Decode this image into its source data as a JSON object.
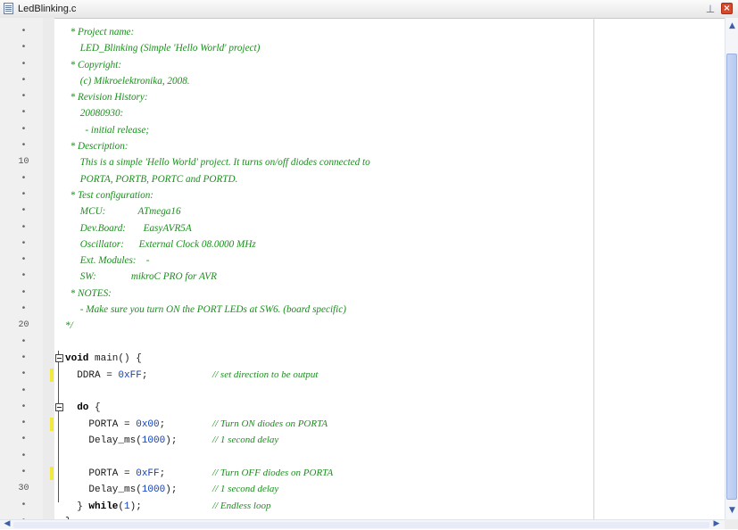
{
  "tab": {
    "title": "LedBlinking.c",
    "pin_icon": "pin-icon",
    "close_icon": "close-icon"
  },
  "editor": {
    "lines": [
      {
        "num": "•",
        "text": "  * Project name:",
        "type": "comment"
      },
      {
        "num": "•",
        "text": "      LED_Blinking (Simple 'Hello World' project)",
        "type": "comment"
      },
      {
        "num": "•",
        "text": "  * Copyright:",
        "type": "comment"
      },
      {
        "num": "•",
        "text": "      (c) Mikroelektronika, 2008.",
        "type": "comment"
      },
      {
        "num": "•",
        "text": "  * Revision History:",
        "type": "comment"
      },
      {
        "num": "•",
        "text": "      20080930:",
        "type": "comment"
      },
      {
        "num": "•",
        "text": "        - initial release;",
        "type": "comment"
      },
      {
        "num": "•",
        "text": "  * Description:",
        "type": "comment"
      },
      {
        "num": "10",
        "text": "      This is a simple 'Hello World' project. It turns on/off diodes connected to",
        "type": "comment"
      },
      {
        "num": "•",
        "text": "      PORTA, PORTB, PORTC and PORTD.",
        "type": "comment"
      },
      {
        "num": "•",
        "text": "  * Test configuration:",
        "type": "comment"
      },
      {
        "num": "•",
        "text": "      MCU:             ATmega16",
        "type": "comment"
      },
      {
        "num": "•",
        "text": "      Dev.Board:       EasyAVR5A",
        "type": "comment"
      },
      {
        "num": "•",
        "text": "      Oscillator:      External Clock 08.0000 MHz",
        "type": "comment"
      },
      {
        "num": "•",
        "text": "      Ext. Modules:    -",
        "type": "comment"
      },
      {
        "num": "•",
        "text": "      SW:              mikroC PRO for AVR",
        "type": "comment"
      },
      {
        "num": "•",
        "text": "  * NOTES:",
        "type": "comment"
      },
      {
        "num": "•",
        "text": "      - Make sure you turn ON the PORT LEDs at SW6. (board specific)",
        "type": "comment"
      },
      {
        "num": "20",
        "text": "*/",
        "type": "comment"
      },
      {
        "num": "•",
        "text": "",
        "type": "code"
      },
      {
        "num": "•",
        "text": "void main() {",
        "type": "code",
        "fold": true
      },
      {
        "num": "•",
        "text": "  DDRA = 0xFF;           // set direction to be output",
        "type": "code",
        "changed": true
      },
      {
        "num": "•",
        "text": "",
        "type": "code"
      },
      {
        "num": "•",
        "text": "  do {",
        "type": "code",
        "fold": true
      },
      {
        "num": "•",
        "text": "    PORTA = 0x00;        // Turn ON diodes on PORTA",
        "type": "code",
        "changed": true
      },
      {
        "num": "•",
        "text": "    Delay_ms(1000);      // 1 second delay",
        "type": "code"
      },
      {
        "num": "•",
        "text": "",
        "type": "code"
      },
      {
        "num": "•",
        "text": "    PORTA = 0xFF;        // Turn OFF diodes on PORTA",
        "type": "code",
        "changed": true
      },
      {
        "num": "30",
        "text": "    Delay_ms(1000);      // 1 second delay",
        "type": "code"
      },
      {
        "num": "•",
        "text": "  } while(1);            // Endless loop",
        "type": "code"
      },
      {
        "num": "•",
        "text": "}",
        "type": "code"
      }
    ]
  },
  "scrollbars": {
    "up_icon": "scroll-up-icon",
    "down_icon": "scroll-down-icon",
    "left_icon": "scroll-left-icon",
    "right_icon": "scroll-right-icon"
  },
  "colors": {
    "comment": "#198f1b",
    "keyword": "#000000",
    "number": "#1040c0",
    "change_marker": "#f2ea3a"
  }
}
